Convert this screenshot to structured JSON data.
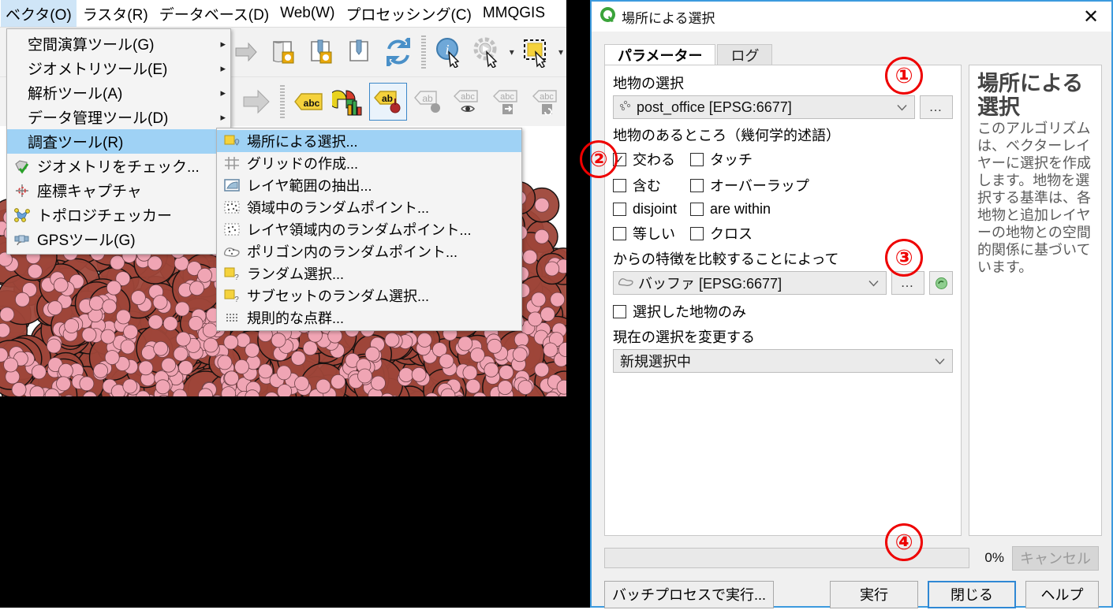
{
  "app": {
    "menubar": [
      {
        "label": "ベクタ(O)",
        "active": true
      },
      {
        "label": "ラスタ(R)",
        "active": false
      },
      {
        "label": "データベース(D)",
        "active": false
      },
      {
        "label": "Web(W)",
        "active": false
      },
      {
        "label": "プロセッシング(C)",
        "active": false
      },
      {
        "label": "MMQGIS",
        "active": false
      }
    ]
  },
  "vector_menu": {
    "items": [
      {
        "label": "空間演算ツール(G)",
        "icon": "",
        "submenu_arrow": "▸",
        "highlight": false
      },
      {
        "label": "ジオメトリツール(E)",
        "icon": "",
        "submenu_arrow": "▸",
        "highlight": false
      },
      {
        "label": "解析ツール(A)",
        "icon": "",
        "submenu_arrow": "▸",
        "highlight": false
      },
      {
        "label": "データ管理ツール(D)",
        "icon": "",
        "submenu_arrow": "▸",
        "highlight": false
      },
      {
        "label": "調査ツール(R)",
        "icon": "",
        "submenu_arrow": "▸",
        "highlight": true
      },
      {
        "label": "ジオメトリをチェック...",
        "icon": "check-geometry-icon",
        "submenu_arrow": "",
        "highlight": false
      },
      {
        "label": "座標キャプチャ",
        "icon": "coordinate-capture-icon",
        "submenu_arrow": "",
        "highlight": false
      },
      {
        "label": "トポロジチェッカー",
        "icon": "topology-checker-icon",
        "submenu_arrow": "",
        "highlight": false
      },
      {
        "label": "GPSツール(G)",
        "icon": "gps-tools-icon",
        "submenu_arrow": "",
        "highlight": false
      }
    ]
  },
  "research_submenu": {
    "items": [
      {
        "label": "場所による選択...",
        "icon": "select-by-location-icon",
        "highlight": true
      },
      {
        "label": "グリッドの作成...",
        "icon": "create-grid-icon",
        "highlight": false
      },
      {
        "label": "レイヤ範囲の抽出...",
        "icon": "extract-layer-extent-icon",
        "highlight": false
      },
      {
        "label": "領域中のランダムポイント...",
        "icon": "random-points-in-extent-icon",
        "highlight": false
      },
      {
        "label": "レイヤ領域内のランダムポイント...",
        "icon": "random-points-in-layer-extent-icon",
        "highlight": false
      },
      {
        "label": "ポリゴン内のランダムポイント...",
        "icon": "random-points-in-polygons-icon",
        "highlight": false
      },
      {
        "label": "ランダム選択...",
        "icon": "random-selection-icon",
        "highlight": false
      },
      {
        "label": "サブセットのランダム選択...",
        "icon": "random-selection-subset-icon",
        "highlight": false
      },
      {
        "label": "規則的な点群...",
        "icon": "regular-points-icon",
        "highlight": false
      }
    ]
  },
  "dialog": {
    "title": "場所による選択",
    "close_icon": "✕",
    "tabs": [
      {
        "label": "パラメーター",
        "selected": true
      },
      {
        "label": "ログ",
        "selected": false
      }
    ],
    "params": {
      "input_layer_label": "地物の選択",
      "input_layer_value": "post_office [EPSG:6677]",
      "input_layer_more_button": "…",
      "predicate_label": "地物のあるところ（幾何学的述語）",
      "predicates": [
        {
          "label": "交わる",
          "checked": true
        },
        {
          "label": "タッチ",
          "checked": false
        },
        {
          "label": "含む",
          "checked": false
        },
        {
          "label": "オーバーラップ",
          "checked": false
        },
        {
          "label": "disjoint",
          "checked": false
        },
        {
          "label": "are within",
          "checked": false
        },
        {
          "label": "等しい",
          "checked": false
        },
        {
          "label": "クロス",
          "checked": false
        }
      ],
      "intersect_layer_label": "からの特徴を比較することによって",
      "intersect_layer_value": "バッファ [EPSG:6677]",
      "intersect_more_button": "…",
      "intersect_iterate_button": "↻",
      "selected_only_label": "選択した地物のみ",
      "selected_only_checked": false,
      "modify_selection_label": "現在の選択を変更する",
      "modify_selection_value": "新規選択中"
    },
    "help": {
      "title": "場所による選択",
      "body": "このアルゴリズムは、ベクターレイヤーに選択を作成します。地物を選択する基準は、各地物と追加レイヤーの地物との空間的関係に基づいています。"
    },
    "footer": {
      "progress_percent": "0%",
      "cancel_label": "キャンセル",
      "batch_label": "バッチプロセスで実行...",
      "run_label": "実行",
      "close_label": "閉じる",
      "help_label": "ヘルプ"
    }
  },
  "annotations": [
    {
      "label": "①"
    },
    {
      "label": "②"
    },
    {
      "label": "③"
    },
    {
      "label": "④"
    }
  ],
  "colors": {
    "accent_blue": "#3c9ade",
    "menu_highlight": "#9fd2f5",
    "annotation_red": "#ee0000",
    "buffer_fill": "#9e4639",
    "point_fill": "#f0a5b4"
  }
}
